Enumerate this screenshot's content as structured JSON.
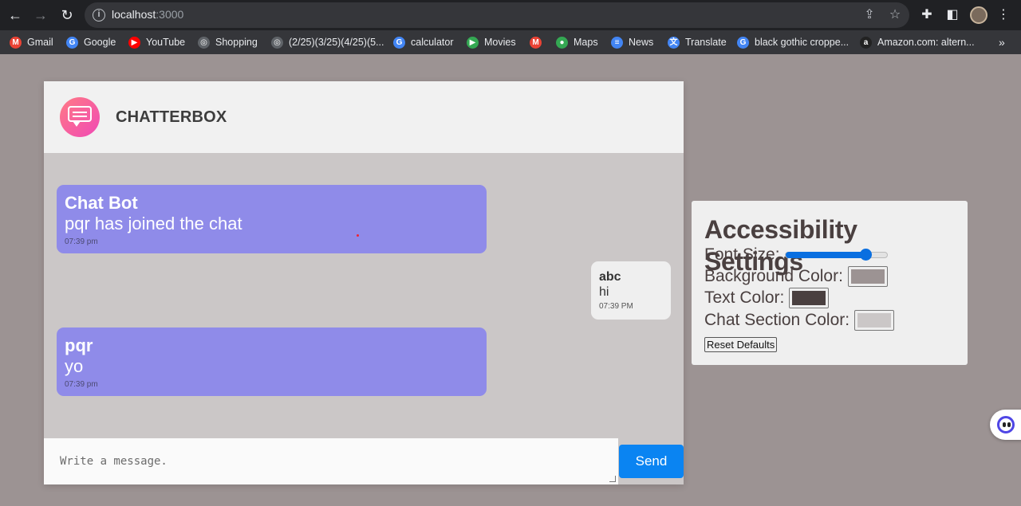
{
  "browser": {
    "url_host": "localhost",
    "url_port": ":3000",
    "bookmarks": [
      {
        "label": "Gmail",
        "icon": "gmail-icon",
        "color": "#ea4335",
        "glyph": "M"
      },
      {
        "label": "Google",
        "icon": "google-icon",
        "color": "#4285f4",
        "glyph": "G"
      },
      {
        "label": "YouTube",
        "icon": "youtube-icon",
        "color": "#ff0000",
        "glyph": "▶"
      },
      {
        "label": "Shopping",
        "icon": "globe-icon",
        "color": "#5f6368",
        "glyph": "◎"
      },
      {
        "label": "(2/25)(3/25)(4/25)(5...",
        "icon": "globe-icon",
        "color": "#5f6368",
        "glyph": "◎"
      },
      {
        "label": "calculator",
        "icon": "google-icon",
        "color": "#4285f4",
        "glyph": "G"
      },
      {
        "label": "Movies",
        "icon": "play-icon",
        "color": "#34a853",
        "glyph": "▶"
      },
      {
        "label": "",
        "icon": "gmail-icon",
        "color": "#ea4335",
        "glyph": "M"
      },
      {
        "label": "Maps",
        "icon": "maps-icon",
        "color": "#34a853",
        "glyph": "●"
      },
      {
        "label": "News",
        "icon": "news-icon",
        "color": "#4285f4",
        "glyph": "≡"
      },
      {
        "label": "Translate",
        "icon": "translate-icon",
        "color": "#4285f4",
        "glyph": "文"
      },
      {
        "label": "black gothic croppe...",
        "icon": "google-icon",
        "color": "#4285f4",
        "glyph": "G"
      },
      {
        "label": "Amazon.com: altern...",
        "icon": "amazon-icon",
        "color": "#222222",
        "glyph": "a"
      }
    ],
    "more_label": "»"
  },
  "chat": {
    "title": "CHATTERBOX",
    "messages": [
      {
        "side": "left",
        "sender": "Chat Bot",
        "text": "pqr has joined the chat",
        "time": "07:39 pm"
      },
      {
        "side": "right",
        "sender": "abc",
        "text": "hi",
        "time": "07:39 PM"
      },
      {
        "side": "left",
        "sender": "pqr",
        "text": "yo",
        "time": "07:39 pm"
      }
    ],
    "input_placeholder": "Write a message.",
    "send_label": "Send",
    "bubble_color": "#8f8be9"
  },
  "settings": {
    "title": "Accessibility Settings",
    "font_size_label": "Font Size:",
    "font_size_fraction": 0.8,
    "background_label": "Background Color:",
    "background_value": "#9c9393",
    "text_label": "Text Color:",
    "text_value": "#4a4040",
    "chat_section_label": "Chat Section Color:",
    "chat_section_value": "#cbc7c7",
    "reset_label": "Reset Defaults"
  }
}
